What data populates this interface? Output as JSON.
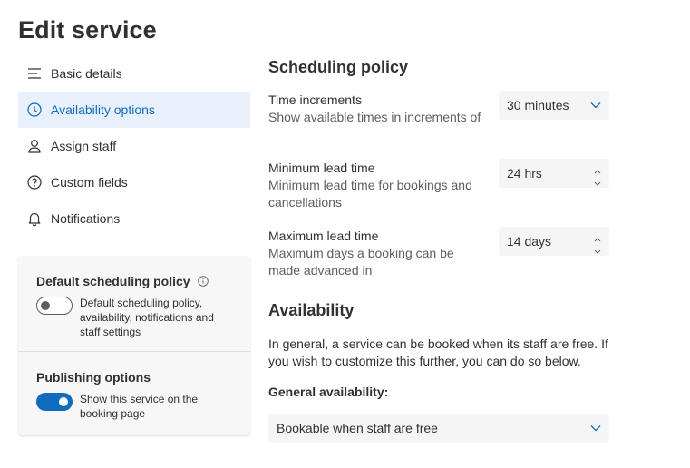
{
  "page": {
    "title": "Edit service"
  },
  "nav": {
    "items": [
      {
        "label": "Basic details",
        "icon": "lines-icon",
        "active": false
      },
      {
        "label": "Availability options",
        "icon": "clock-icon",
        "active": true
      },
      {
        "label": "Assign staff",
        "icon": "person-icon",
        "active": false
      },
      {
        "label": "Custom fields",
        "icon": "question-circle-icon",
        "active": false
      },
      {
        "label": "Notifications",
        "icon": "bell-icon",
        "active": false
      }
    ]
  },
  "card": {
    "default_policy": {
      "title": "Default scheduling policy",
      "toggle_on": false,
      "description": "Default scheduling policy, availability, notifications and staff settings"
    },
    "publishing": {
      "title": "Publishing options",
      "toggle_on": true,
      "description": "Show this service on the booking page"
    }
  },
  "scheduling": {
    "title": "Scheduling policy",
    "time_increments": {
      "label": "Time increments",
      "description": "Show available times in increments of",
      "value": "30 minutes"
    },
    "min_lead": {
      "label": "Minimum lead time",
      "description": "Minimum lead time for bookings and cancellations",
      "value": "24 hrs"
    },
    "max_lead": {
      "label": "Maximum lead time",
      "description": "Maximum days a booking can be made advanced in",
      "value": "14 days"
    }
  },
  "availability": {
    "title": "Availability",
    "description": "In general, a service can be booked when its staff are free. If you wish to customize this further, you can do so below.",
    "general_label": "General availability:",
    "general_value": "Bookable when staff are free"
  },
  "colors": {
    "accent": "#0f6cbd",
    "active_bg": "#e8f1fb",
    "control_bg": "#f5f5f5",
    "card_bg": "#f7f7f7"
  }
}
